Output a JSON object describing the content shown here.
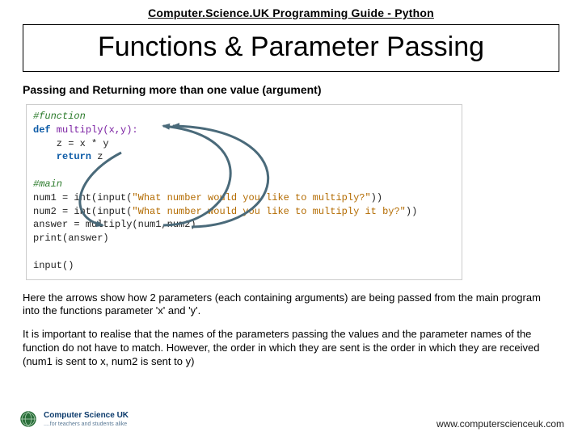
{
  "top_title": "Computer.Science.UK Programming Guide - Python",
  "heading": "Functions & Parameter Passing",
  "subhead": "Passing and Returning more than one value (argument)",
  "code": {
    "l1_comment": "#function",
    "l2_def": "def",
    "l2_name": " multiply(x,y):",
    "l3": "    z = x * y",
    "l4_ret": "    return",
    "l4_z": " z",
    "l6_comment": "#main",
    "l7a": "num1 = int(input(",
    "l7s": "\"What number would you like to multiply?\"",
    "l7b": "))",
    "l8a": "num2 = int(input(",
    "l8s": "\"What number would you like to multiply it by?\"",
    "l8b": "))",
    "l9a": "answer = multiply(num1,num2)",
    "l10a": "print(answer)",
    "l12a": "input()"
  },
  "para1": "Here the arrows show how 2 parameters (each containing arguments) are being passed from the main program into the functions parameter 'x' and 'y'.",
  "para2": "It is important to realise that the names of the parameters passing the values and the parameter names of the function do not have to match. However, the order in which they are sent is the order in which they are received (num1 is sent to x, num2 is sent to y)",
  "footer": {
    "brand1": "Computer Science UK",
    "brand2": "....for teachers and students alike",
    "url": "www.computerscienceuk.com"
  }
}
